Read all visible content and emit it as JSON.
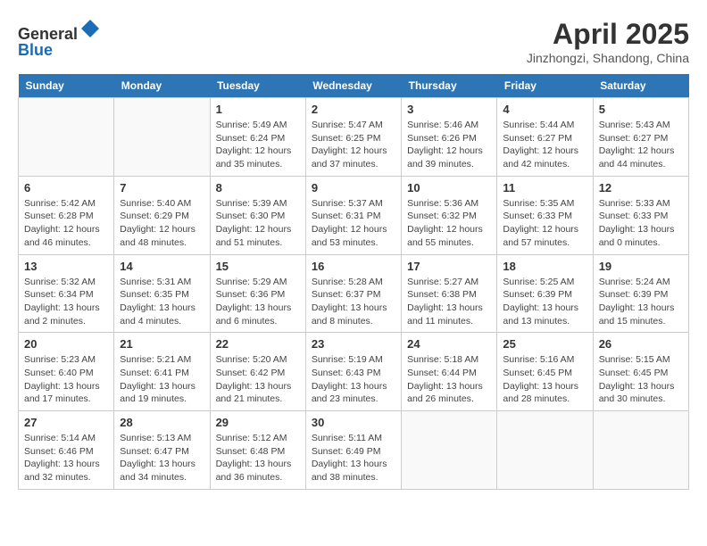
{
  "header": {
    "logo_line1": "General",
    "logo_line2": "Blue",
    "month": "April 2025",
    "location": "Jinzhongzi, Shandong, China"
  },
  "weekdays": [
    "Sunday",
    "Monday",
    "Tuesday",
    "Wednesday",
    "Thursday",
    "Friday",
    "Saturday"
  ],
  "weeks": [
    [
      {
        "day": "",
        "info": ""
      },
      {
        "day": "",
        "info": ""
      },
      {
        "day": "1",
        "info": "Sunrise: 5:49 AM\nSunset: 6:24 PM\nDaylight: 12 hours and 35 minutes."
      },
      {
        "day": "2",
        "info": "Sunrise: 5:47 AM\nSunset: 6:25 PM\nDaylight: 12 hours and 37 minutes."
      },
      {
        "day": "3",
        "info": "Sunrise: 5:46 AM\nSunset: 6:26 PM\nDaylight: 12 hours and 39 minutes."
      },
      {
        "day": "4",
        "info": "Sunrise: 5:44 AM\nSunset: 6:27 PM\nDaylight: 12 hours and 42 minutes."
      },
      {
        "day": "5",
        "info": "Sunrise: 5:43 AM\nSunset: 6:27 PM\nDaylight: 12 hours and 44 minutes."
      }
    ],
    [
      {
        "day": "6",
        "info": "Sunrise: 5:42 AM\nSunset: 6:28 PM\nDaylight: 12 hours and 46 minutes."
      },
      {
        "day": "7",
        "info": "Sunrise: 5:40 AM\nSunset: 6:29 PM\nDaylight: 12 hours and 48 minutes."
      },
      {
        "day": "8",
        "info": "Sunrise: 5:39 AM\nSunset: 6:30 PM\nDaylight: 12 hours and 51 minutes."
      },
      {
        "day": "9",
        "info": "Sunrise: 5:37 AM\nSunset: 6:31 PM\nDaylight: 12 hours and 53 minutes."
      },
      {
        "day": "10",
        "info": "Sunrise: 5:36 AM\nSunset: 6:32 PM\nDaylight: 12 hours and 55 minutes."
      },
      {
        "day": "11",
        "info": "Sunrise: 5:35 AM\nSunset: 6:33 PM\nDaylight: 12 hours and 57 minutes."
      },
      {
        "day": "12",
        "info": "Sunrise: 5:33 AM\nSunset: 6:33 PM\nDaylight: 13 hours and 0 minutes."
      }
    ],
    [
      {
        "day": "13",
        "info": "Sunrise: 5:32 AM\nSunset: 6:34 PM\nDaylight: 13 hours and 2 minutes."
      },
      {
        "day": "14",
        "info": "Sunrise: 5:31 AM\nSunset: 6:35 PM\nDaylight: 13 hours and 4 minutes."
      },
      {
        "day": "15",
        "info": "Sunrise: 5:29 AM\nSunset: 6:36 PM\nDaylight: 13 hours and 6 minutes."
      },
      {
        "day": "16",
        "info": "Sunrise: 5:28 AM\nSunset: 6:37 PM\nDaylight: 13 hours and 8 minutes."
      },
      {
        "day": "17",
        "info": "Sunrise: 5:27 AM\nSunset: 6:38 PM\nDaylight: 13 hours and 11 minutes."
      },
      {
        "day": "18",
        "info": "Sunrise: 5:25 AM\nSunset: 6:39 PM\nDaylight: 13 hours and 13 minutes."
      },
      {
        "day": "19",
        "info": "Sunrise: 5:24 AM\nSunset: 6:39 PM\nDaylight: 13 hours and 15 minutes."
      }
    ],
    [
      {
        "day": "20",
        "info": "Sunrise: 5:23 AM\nSunset: 6:40 PM\nDaylight: 13 hours and 17 minutes."
      },
      {
        "day": "21",
        "info": "Sunrise: 5:21 AM\nSunset: 6:41 PM\nDaylight: 13 hours and 19 minutes."
      },
      {
        "day": "22",
        "info": "Sunrise: 5:20 AM\nSunset: 6:42 PM\nDaylight: 13 hours and 21 minutes."
      },
      {
        "day": "23",
        "info": "Sunrise: 5:19 AM\nSunset: 6:43 PM\nDaylight: 13 hours and 23 minutes."
      },
      {
        "day": "24",
        "info": "Sunrise: 5:18 AM\nSunset: 6:44 PM\nDaylight: 13 hours and 26 minutes."
      },
      {
        "day": "25",
        "info": "Sunrise: 5:16 AM\nSunset: 6:45 PM\nDaylight: 13 hours and 28 minutes."
      },
      {
        "day": "26",
        "info": "Sunrise: 5:15 AM\nSunset: 6:45 PM\nDaylight: 13 hours and 30 minutes."
      }
    ],
    [
      {
        "day": "27",
        "info": "Sunrise: 5:14 AM\nSunset: 6:46 PM\nDaylight: 13 hours and 32 minutes."
      },
      {
        "day": "28",
        "info": "Sunrise: 5:13 AM\nSunset: 6:47 PM\nDaylight: 13 hours and 34 minutes."
      },
      {
        "day": "29",
        "info": "Sunrise: 5:12 AM\nSunset: 6:48 PM\nDaylight: 13 hours and 36 minutes."
      },
      {
        "day": "30",
        "info": "Sunrise: 5:11 AM\nSunset: 6:49 PM\nDaylight: 13 hours and 38 minutes."
      },
      {
        "day": "",
        "info": ""
      },
      {
        "day": "",
        "info": ""
      },
      {
        "day": "",
        "info": ""
      }
    ]
  ]
}
